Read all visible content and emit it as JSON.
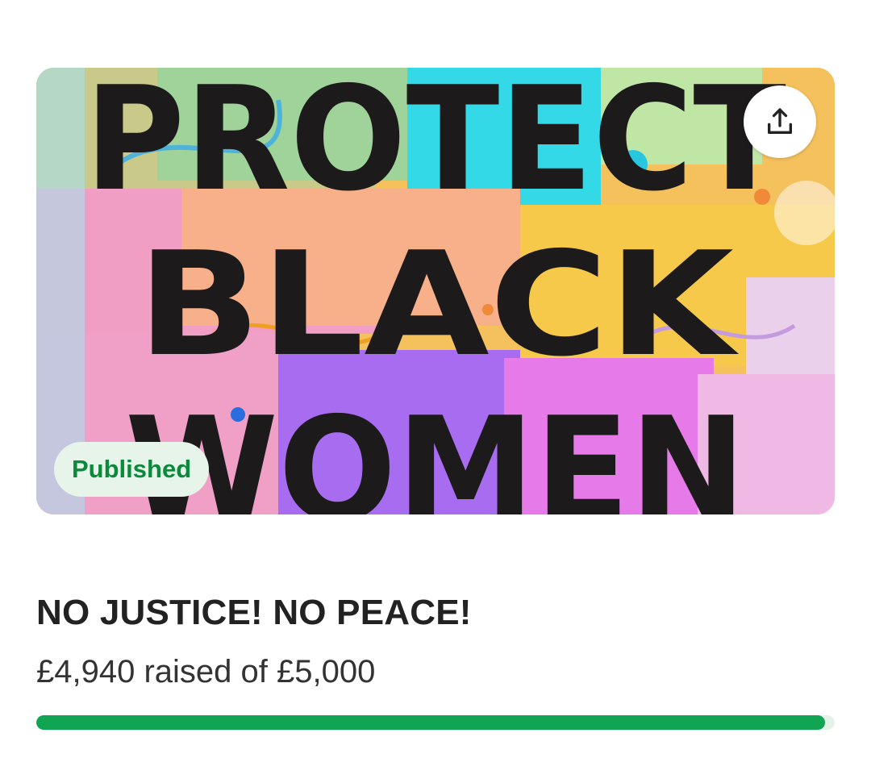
{
  "campaign": {
    "image_text": [
      "PROTECT",
      "BLACK",
      "WOMEN"
    ],
    "status_badge": "Published",
    "share_icon": "share-upload-icon",
    "title": "NO JUSTICE! NO PEACE!",
    "raised_text": "£4,940 raised of £5,000",
    "raised_amount": 4940,
    "goal_amount": 5000,
    "progress_fraction": 0.988
  },
  "colors": {
    "badge_background": "#e6f4ea",
    "badge_text": "#0a8a3a",
    "progress_fill": "#0fa553",
    "progress_track": "#e4f3e8",
    "title_text": "#222222"
  }
}
